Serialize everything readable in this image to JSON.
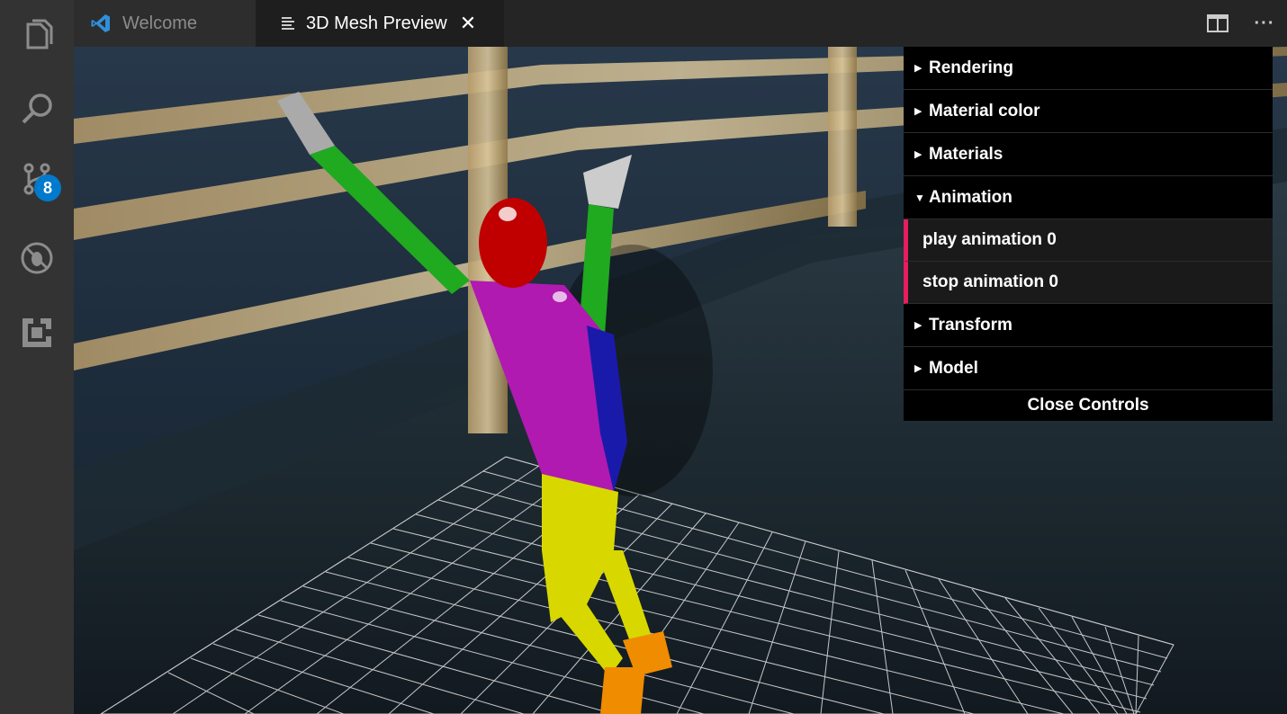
{
  "activity_bar": {
    "items": [
      {
        "name": "explorer",
        "icon": "files-icon"
      },
      {
        "name": "search",
        "icon": "search-icon"
      },
      {
        "name": "source-control",
        "icon": "source-control-icon",
        "badge": "8"
      },
      {
        "name": "debug",
        "icon": "no-bug-icon"
      },
      {
        "name": "extensions",
        "icon": "extensions-icon"
      }
    ],
    "badge_color": "#007acc"
  },
  "tabs": [
    {
      "label": "Welcome",
      "icon": "vscode-logo-icon",
      "active": false
    },
    {
      "label": "3D Mesh Preview",
      "icon": "preview-icon",
      "active": true,
      "close": "✕"
    }
  ],
  "editor_actions": {
    "split": "split-editor-icon",
    "more": "···"
  },
  "controls": {
    "folders": [
      {
        "label": "Rendering",
        "open": false
      },
      {
        "label": "Material color",
        "open": false
      },
      {
        "label": "Materials",
        "open": false
      },
      {
        "label": "Animation",
        "open": true,
        "items": [
          "play animation 0",
          "stop animation 0"
        ]
      },
      {
        "label": "Transform",
        "open": false
      },
      {
        "label": "Model",
        "open": false
      }
    ],
    "close_label": "Close Controls",
    "accent": "#e61d5f"
  },
  "scene": {
    "description_colors": {
      "head": "#c00000",
      "torso": "#b01ab0",
      "arms": "#1faa1f",
      "legs": "#d8d800",
      "feet": "#f08c00",
      "side": "#1a1aaa"
    }
  }
}
